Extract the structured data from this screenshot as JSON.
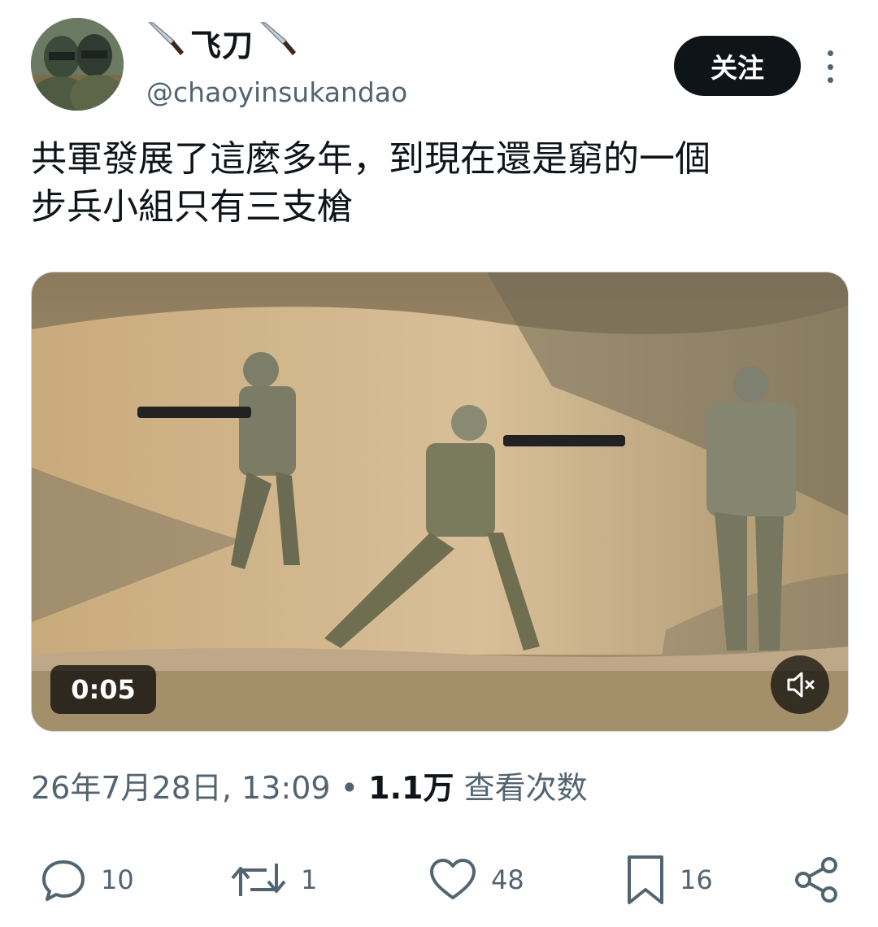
{
  "user": {
    "display_name": "飞刀",
    "handle": "@chaoyinsukandao",
    "name_decoration_icon": "knife-icon"
  },
  "follow_label": "关注",
  "tweet": {
    "text": "共軍發展了這麼多年，到現在還是窮的一個\n步兵小組只有三支槍"
  },
  "media": {
    "duration": "0:05",
    "mute_icon": "volume-muted-icon"
  },
  "meta": {
    "date": "26年7月28日, 13:09",
    "separator": "•",
    "views_count": "1.1万",
    "views_label": "查看次数"
  },
  "actions": {
    "replies": "10",
    "reposts": "1",
    "likes": "48",
    "bookmarks": "16"
  },
  "colors": {
    "text": "#0f1419",
    "secondary": "#536471",
    "follow_bg": "#0f1419"
  }
}
